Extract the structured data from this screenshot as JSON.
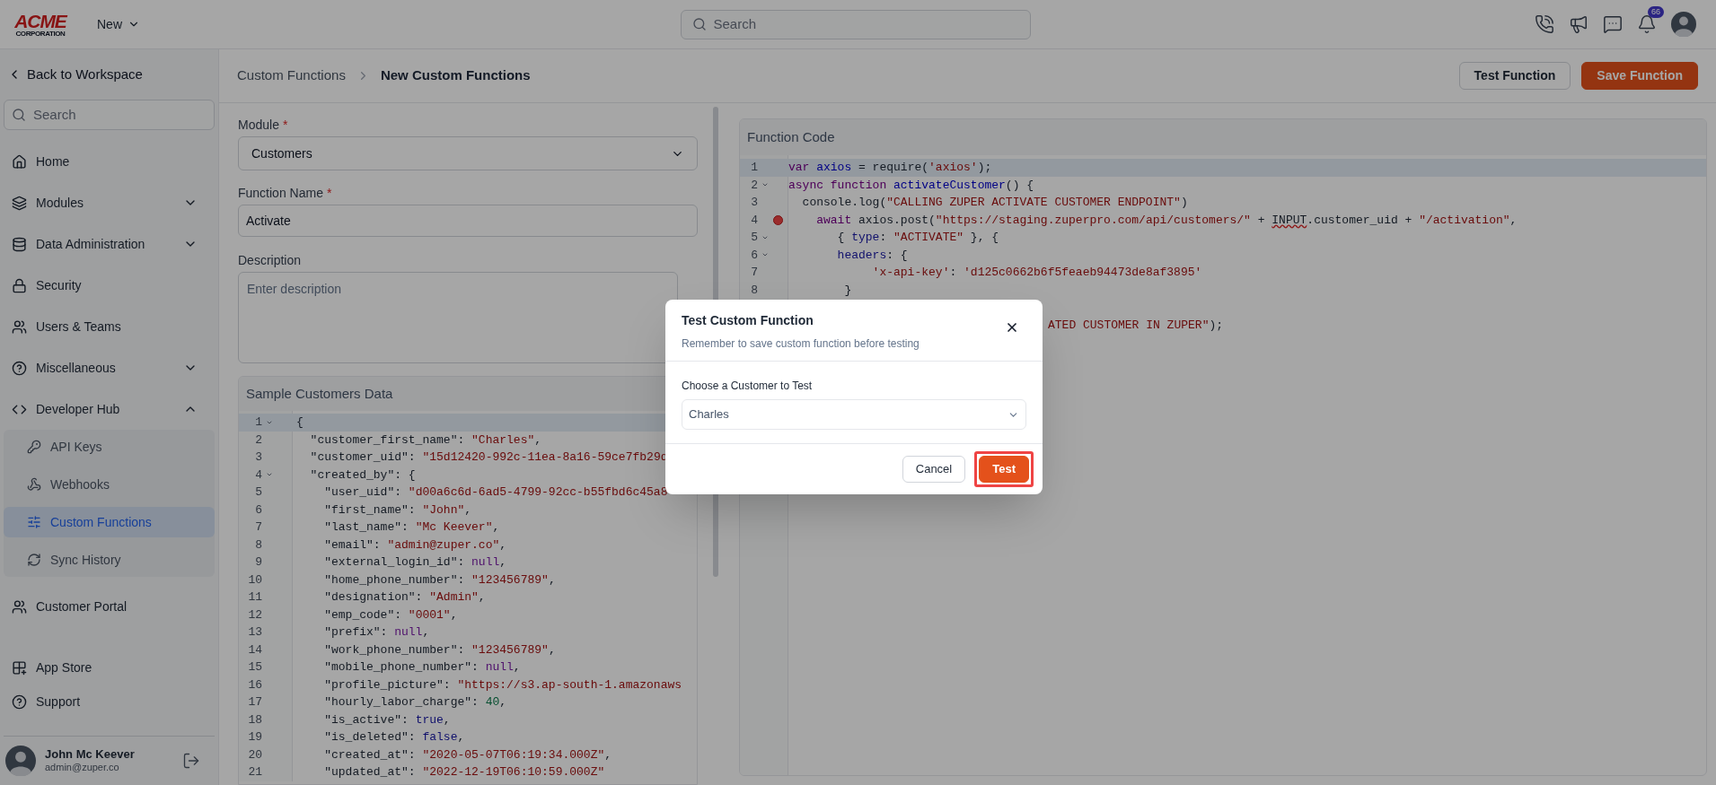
{
  "header": {
    "logo": {
      "title": "ACME",
      "subtitle": "CORPORATION"
    },
    "new_menu": "New",
    "search": {
      "placeholder": "Search"
    },
    "notification_count": "66"
  },
  "sidebar": {
    "back": "Back to Workspace",
    "search": {
      "placeholder": "Search"
    },
    "nav": [
      {
        "label": "Home"
      },
      {
        "label": "Modules",
        "expanded": false
      },
      {
        "label": "Data Administration",
        "expanded": false
      },
      {
        "label": "Security"
      },
      {
        "label": "Users & Teams"
      },
      {
        "label": "Miscellaneous",
        "expanded": false
      },
      {
        "label": "Developer Hub",
        "expanded": true,
        "children": [
          {
            "label": "API Keys",
            "selected": false
          },
          {
            "label": "Webhooks",
            "selected": false
          },
          {
            "label": "Custom Functions",
            "selected": true
          },
          {
            "label": "Sync History",
            "selected": false
          }
        ]
      },
      {
        "label": "Customer Portal"
      }
    ],
    "bottom_nav": [
      {
        "label": "App Store"
      },
      {
        "label": "Support"
      }
    ],
    "user": {
      "name": "John Mc Keever",
      "email": "admin@zuper.co"
    }
  },
  "breadcrumb": [
    "Custom Functions",
    "New Custom Functions"
  ],
  "actions": [
    {
      "label": "Test Function",
      "kind": "secondary"
    },
    {
      "label": "Save Function",
      "kind": "primary"
    }
  ],
  "form": {
    "module": {
      "label": "Module",
      "required_mark": "*",
      "value": "Customers"
    },
    "function_name": {
      "label": "Function Name",
      "required_mark": "*",
      "value": "Activate"
    },
    "description": {
      "label": "Description",
      "placeholder": "Enter description"
    }
  },
  "sample_panel": {
    "title": "Sample Customers Data",
    "lines": [
      {
        "number": "1",
        "foldable": true,
        "active": true,
        "tokens": [
          {
            "kind": "plain",
            "text": "{"
          }
        ]
      },
      {
        "number": "2",
        "tokens": [
          {
            "kind": "plain",
            "text": "  \"customer_first_name\": "
          },
          {
            "kind": "string",
            "text": "\"Charles\""
          },
          {
            "kind": "plain",
            "text": ","
          }
        ]
      },
      {
        "number": "3",
        "tokens": [
          {
            "kind": "plain",
            "text": "  \"customer_uid\": "
          },
          {
            "kind": "string",
            "text": "\"15d12420-992c-11ea-8a16-59ce7fb29d"
          }
        ]
      },
      {
        "number": "4",
        "foldable": true,
        "tokens": [
          {
            "kind": "plain",
            "text": "  \"created_by\": {"
          }
        ]
      },
      {
        "number": "5",
        "tokens": [
          {
            "kind": "plain",
            "text": "    \"user_uid\": "
          },
          {
            "kind": "string",
            "text": "\"d00a6c6d-6ad5-4799-92cc-b55fbd6c45a8"
          }
        ]
      },
      {
        "number": "6",
        "tokens": [
          {
            "kind": "plain",
            "text": "    \"first_name\": "
          },
          {
            "kind": "string",
            "text": "\"John\""
          },
          {
            "kind": "plain",
            "text": ","
          }
        ]
      },
      {
        "number": "7",
        "tokens": [
          {
            "kind": "plain",
            "text": "    \"last_name\": "
          },
          {
            "kind": "string",
            "text": "\"Mc Keever\""
          },
          {
            "kind": "plain",
            "text": ","
          }
        ]
      },
      {
        "number": "8",
        "tokens": [
          {
            "kind": "plain",
            "text": "    \"email\": "
          },
          {
            "kind": "string",
            "text": "\"admin@zuper.co\""
          },
          {
            "kind": "plain",
            "text": ","
          }
        ]
      },
      {
        "number": "9",
        "tokens": [
          {
            "kind": "plain",
            "text": "    \"external_login_id\": "
          },
          {
            "kind": "null",
            "text": "null"
          },
          {
            "kind": "plain",
            "text": ","
          }
        ]
      },
      {
        "number": "10",
        "tokens": [
          {
            "kind": "plain",
            "text": "    \"home_phone_number\": "
          },
          {
            "kind": "string",
            "text": "\"123456789\""
          },
          {
            "kind": "plain",
            "text": ","
          }
        ]
      },
      {
        "number": "11",
        "tokens": [
          {
            "kind": "plain",
            "text": "    \"designation\": "
          },
          {
            "kind": "string",
            "text": "\"Admin\""
          },
          {
            "kind": "plain",
            "text": ","
          }
        ]
      },
      {
        "number": "12",
        "tokens": [
          {
            "kind": "plain",
            "text": "    \"emp_code\": "
          },
          {
            "kind": "string",
            "text": "\"0001\""
          },
          {
            "kind": "plain",
            "text": ","
          }
        ]
      },
      {
        "number": "13",
        "tokens": [
          {
            "kind": "plain",
            "text": "    \"prefix\": "
          },
          {
            "kind": "null",
            "text": "null"
          },
          {
            "kind": "plain",
            "text": ","
          }
        ]
      },
      {
        "number": "14",
        "tokens": [
          {
            "kind": "plain",
            "text": "    \"work_phone_number\": "
          },
          {
            "kind": "string",
            "text": "\"123456789\""
          },
          {
            "kind": "plain",
            "text": ","
          }
        ]
      },
      {
        "number": "15",
        "tokens": [
          {
            "kind": "plain",
            "text": "    \"mobile_phone_number\": "
          },
          {
            "kind": "null",
            "text": "null"
          },
          {
            "kind": "plain",
            "text": ","
          }
        ]
      },
      {
        "number": "16",
        "tokens": [
          {
            "kind": "plain",
            "text": "    \"profile_picture\": "
          },
          {
            "kind": "string",
            "text": "\"https://s3.ap-south-1.amazonaws"
          }
        ]
      },
      {
        "number": "17",
        "tokens": [
          {
            "kind": "plain",
            "text": "    \"hourly_labor_charge\": "
          },
          {
            "kind": "number",
            "text": "40"
          },
          {
            "kind": "plain",
            "text": ","
          }
        ]
      },
      {
        "number": "18",
        "tokens": [
          {
            "kind": "plain",
            "text": "    \"is_active\": "
          },
          {
            "kind": "bool",
            "text": "true"
          },
          {
            "kind": "plain",
            "text": ","
          }
        ]
      },
      {
        "number": "19",
        "tokens": [
          {
            "kind": "plain",
            "text": "    \"is_deleted\": "
          },
          {
            "kind": "bool",
            "text": "false"
          },
          {
            "kind": "plain",
            "text": ","
          }
        ]
      },
      {
        "number": "20",
        "tokens": [
          {
            "kind": "plain",
            "text": "    \"created_at\": "
          },
          {
            "kind": "string",
            "text": "\"2020-05-07T06:19:34.000Z\""
          },
          {
            "kind": "plain",
            "text": ","
          }
        ]
      },
      {
        "number": "21",
        "tokens": [
          {
            "kind": "plain",
            "text": "    \"updated_at\": "
          },
          {
            "kind": "string",
            "text": "\"2022-12-19T06:10:59.000Z\""
          }
        ]
      }
    ]
  },
  "code_panel": {
    "title": "Function Code",
    "lines": [
      {
        "number": "1",
        "active": true,
        "tokens": [
          {
            "kind": "keyword",
            "text": "var"
          },
          {
            "kind": "def",
            "text": " axios"
          },
          {
            "kind": "plain",
            "text": " = require("
          },
          {
            "kind": "string",
            "text": "'axios'"
          },
          {
            "kind": "plain",
            "text": ");"
          }
        ]
      },
      {
        "number": "2",
        "foldable": true,
        "tokens": [
          {
            "kind": "keyword",
            "text": "async function"
          },
          {
            "kind": "def",
            "text": " activateCustomer"
          },
          {
            "kind": "plain",
            "text": "() {"
          }
        ]
      },
      {
        "number": "3",
        "tokens": [
          {
            "kind": "plain",
            "text": "  console.log("
          },
          {
            "kind": "string",
            "text": "\"CALLING ZUPER ACTIVATE CUSTOMER ENDPOINT\""
          },
          {
            "kind": "plain",
            "text": ")"
          }
        ]
      },
      {
        "number": "4",
        "breakpoint": true,
        "tokens": [
          {
            "kind": "keyword",
            "text": "    await"
          },
          {
            "kind": "plain",
            "text": " axios.post("
          },
          {
            "kind": "string",
            "text": "\"https://staging.zuperpro.com/api/customers/\""
          },
          {
            "kind": "plain",
            "text": " + "
          },
          {
            "kind": "flagged",
            "text": "INPUT"
          },
          {
            "kind": "plain",
            "text": ".customer_uid + "
          },
          {
            "kind": "string",
            "text": "\"/activation\""
          },
          {
            "kind": "plain",
            "text": ","
          }
        ]
      },
      {
        "number": "5",
        "foldable": true,
        "tokens": [
          {
            "kind": "plain",
            "text": "       { "
          },
          {
            "kind": "prop",
            "text": "type"
          },
          {
            "kind": "plain",
            "text": ": "
          },
          {
            "kind": "string",
            "text": "\"ACTIVATE\""
          },
          {
            "kind": "plain",
            "text": " }, {"
          }
        ]
      },
      {
        "number": "6",
        "foldable": true,
        "tokens": [
          {
            "kind": "prop",
            "text": "       headers"
          },
          {
            "kind": "plain",
            "text": ": {"
          }
        ]
      },
      {
        "number": "7",
        "tokens": [
          {
            "kind": "string",
            "text": "            'x-api-key'"
          },
          {
            "kind": "plain",
            "text": ": "
          },
          {
            "kind": "string",
            "text": "'d125c0662b6f5feaeb94473de8af3895'"
          }
        ]
      },
      {
        "number": "8",
        "tokens": [
          {
            "kind": "plain",
            "text": "        }"
          }
        ]
      }
    ],
    "covered_tail": [
      {
        "kind": "string",
        "text": "ATED CUSTOMER IN ZUPER\""
      },
      {
        "kind": "plain",
        "text": ");"
      }
    ]
  },
  "modal": {
    "title": "Test Custom Function",
    "subtitle": "Remember to save custom function before testing",
    "field": {
      "label": "Choose a Customer to Test",
      "value": "Charles"
    },
    "buttons": [
      {
        "label": "Cancel",
        "kind": "secondary"
      },
      {
        "label": "Test",
        "kind": "primary",
        "highlighted": true
      }
    ]
  }
}
